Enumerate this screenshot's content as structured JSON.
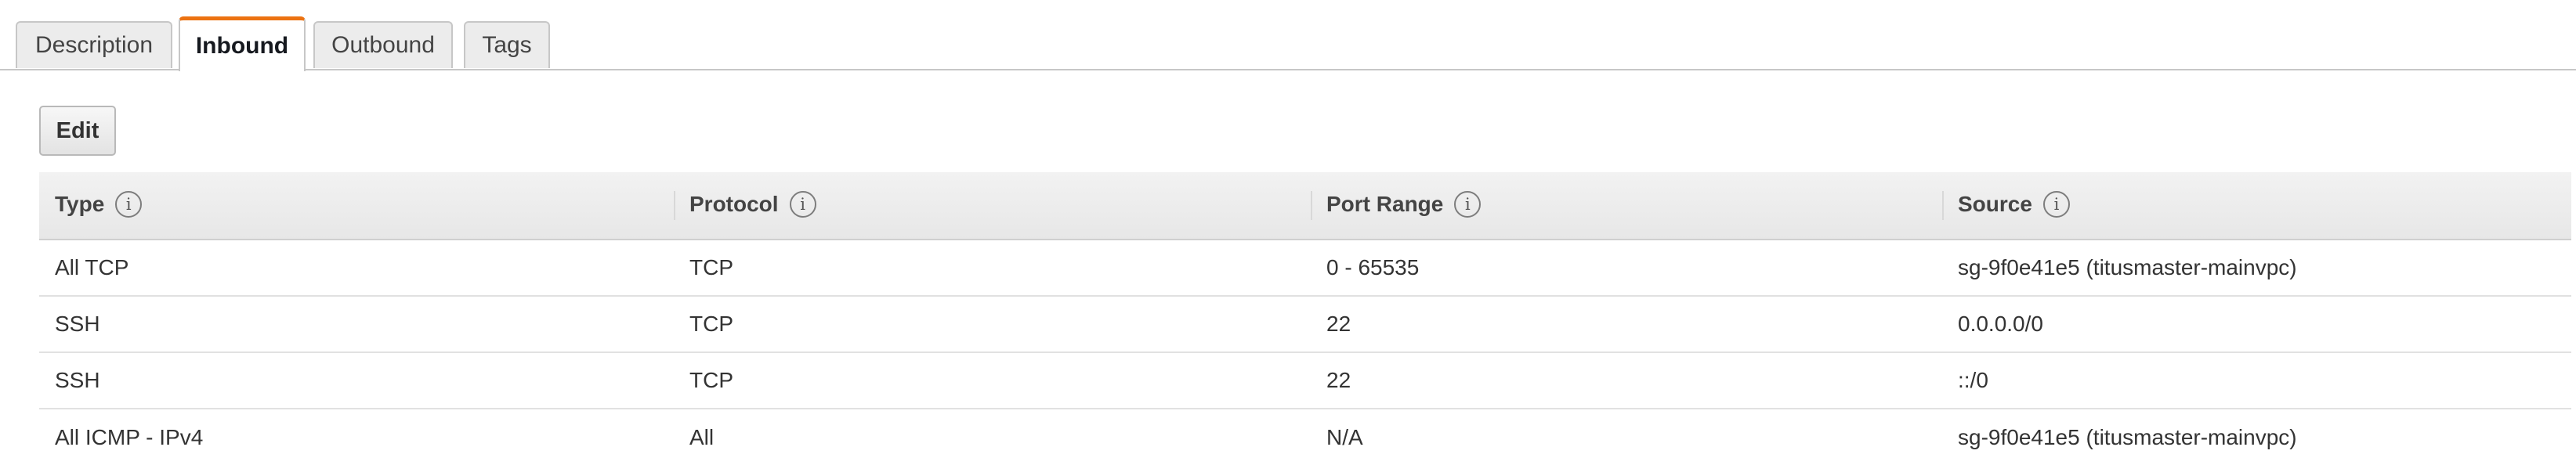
{
  "tabs": [
    {
      "label": "Description"
    },
    {
      "label": "Inbound",
      "active": true
    },
    {
      "label": "Outbound"
    },
    {
      "label": "Tags"
    }
  ],
  "toolbar": {
    "edit_label": "Edit"
  },
  "table": {
    "columns": [
      {
        "label": "Type"
      },
      {
        "label": "Protocol"
      },
      {
        "label": "Port Range"
      },
      {
        "label": "Source"
      }
    ],
    "rows": [
      [
        "All TCP",
        "TCP",
        "0 - 65535",
        "sg-9f0e41e5 (titusmaster-mainvpc)"
      ],
      [
        "SSH",
        "TCP",
        "22",
        "0.0.0.0/0"
      ],
      [
        "SSH",
        "TCP",
        "22",
        "::/0"
      ],
      [
        "All ICMP - IPv4",
        "All",
        "N/A",
        "sg-9f0e41e5 (titusmaster-mainvpc)"
      ]
    ]
  },
  "icons": {
    "info": "i"
  },
  "colors": {
    "active_tab_accent": "#ec7211"
  }
}
